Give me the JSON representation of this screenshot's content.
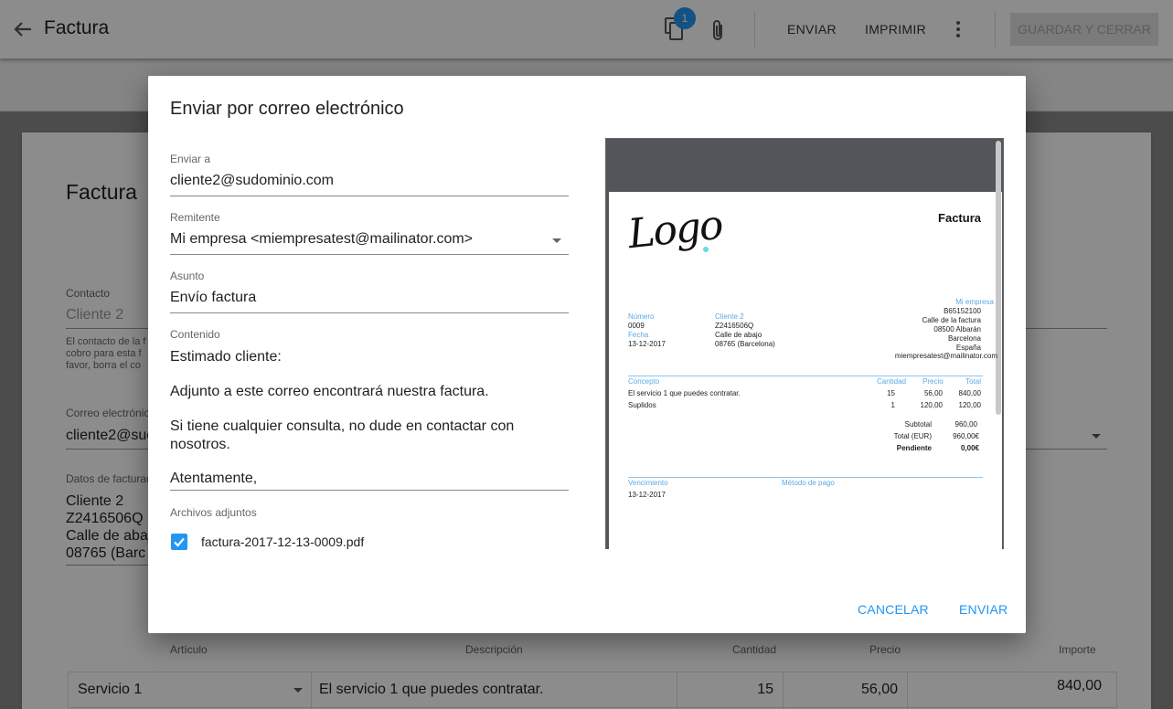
{
  "app": {
    "title": "Factura",
    "copy_badge": "1",
    "actions": {
      "send": "ENVIAR",
      "print": "IMPRIMIR",
      "save_close": "GUARDAR Y CERRAR"
    }
  },
  "background": {
    "invoice_title": "Factura",
    "contact_label": "Contacto",
    "contact_value": "Cliente 2",
    "contact_help_1": "El contacto de la f",
    "contact_help_2": "cobro para esta f",
    "contact_help_3": "favor, borra el co",
    "email_label": "Correo electrónic",
    "email_value": "cliente2@suc",
    "billing_label": "Datos de facturac",
    "billing_lines": [
      "Cliente 2",
      "Z2416506Q",
      "Calle de abaj",
      "08765  (Barc"
    ],
    "table_headers": {
      "item": "Artículo",
      "description": "Descripción",
      "quantity": "Cantidad",
      "price": "Precio",
      "amount": "Importe"
    },
    "row": {
      "item": "Servicio 1",
      "description": "El servicio 1 que puedes contratar.",
      "quantity": "15",
      "price": "56,00",
      "amount": "840,00"
    }
  },
  "dialog": {
    "title": "Enviar por correo electrónico",
    "to_label": "Enviar a",
    "to_value": "cliente2@sudominio.com",
    "sender_label": "Remitente",
    "sender_value": "Mi empresa <miempresatest@mailinator.com>",
    "subject_label": "Asunto",
    "subject_value": "Envío factura",
    "content_label": "Contenido",
    "content_paragraphs": [
      "Estimado cliente:",
      "Adjunto a este correo encontrará nuestra factura.",
      "Si tiene cualquier consulta, no dude en contactar con nosotros.",
      "Atentamente,"
    ],
    "attachments_label": "Archivos adjuntos",
    "attachment_name": "factura-2017-12-13-0009.pdf",
    "attachment_checked": true,
    "cancel_label": "CANCELAR",
    "send_label": "ENVIAR"
  },
  "preview": {
    "logo": "Logo",
    "doc_title": "Factura",
    "company_label": "Mi empresa",
    "company_lines": [
      "B65152100",
      "Calle de la factura",
      "08500 Albarán",
      "Barcelona",
      "España",
      "miempresatest@mailinator.com"
    ],
    "number_label": "Número",
    "number_value": "0009",
    "date_label": "Fecha",
    "date_value": "13-12-2017",
    "client_label": "Cliente 2",
    "client_lines": [
      "Z2416506Q",
      "Calle de abajo",
      "08765  (Barcelona)"
    ],
    "table_headers": {
      "concept": "Concepto",
      "quantity": "Cantidad",
      "price": "Precio",
      "total": "Total"
    },
    "rows": [
      {
        "concept": "El servicio 1 que puedes contratar.",
        "quantity": "15",
        "price": "56,00",
        "total": "840,00"
      },
      {
        "concept": "Suplidos",
        "quantity": "1",
        "price": "120,00",
        "total": "120,00"
      }
    ],
    "subtotal_label": "Subtotal",
    "subtotal_value": "960,00",
    "total_label": "Total (EUR)",
    "total_value": "960,00€",
    "pending_label": "Pendiente",
    "pending_value": "0,00€",
    "due_label": "Vencimiento",
    "due_value": "13-12-2017",
    "payment_label": "Método de pago"
  },
  "colors": {
    "accent": "#2196f3",
    "preview_label": "#5aa9e6"
  }
}
